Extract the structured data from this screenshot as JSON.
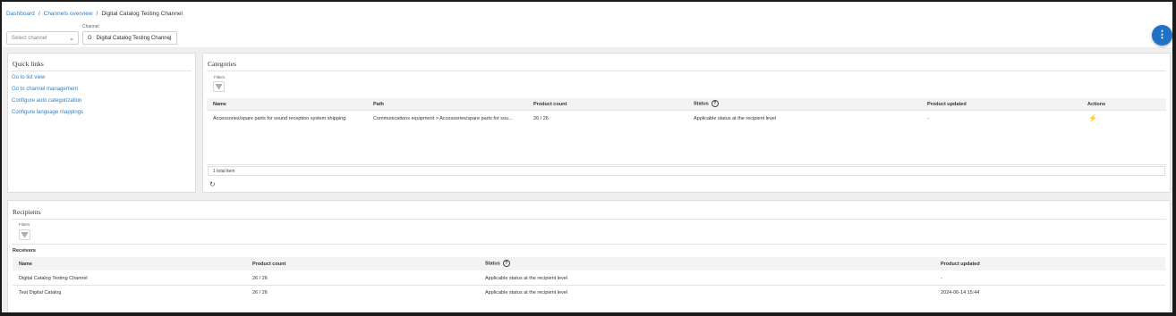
{
  "breadcrumb": {
    "items": [
      "Dashboard",
      "Channels overview"
    ],
    "current": "Digital Catalog Testing Channel"
  },
  "header": {
    "select_channel_placeholder": "Select channel",
    "channel_label": "Channel",
    "channel_value": "Digital Catalog Testing Channel",
    "channel_prefix": "G",
    "fab_icon": "more-vertical-icon"
  },
  "quick_links": {
    "title": "Quick links",
    "items": [
      "Go to list view",
      "Go to channel management",
      "Configure auto categorization",
      "Configure language mappings"
    ]
  },
  "categories": {
    "title": "Categories",
    "filters_label": "Filters",
    "columns": [
      "Name",
      "Path",
      "Product count",
      "Status",
      "Product updated",
      "Actions"
    ],
    "rows": [
      {
        "name": "Accessories/spare parts for sound reception system shipping",
        "path": "Communications equipment > Accessories/spare parts for sou...",
        "count": "26 / 26",
        "status": "Applicable status at the recipient level",
        "updated": "-"
      }
    ],
    "total": "1 total item"
  },
  "recipients": {
    "title": "Recipients",
    "filters_label": "Filters",
    "receivers_label": "Receivers",
    "columns": [
      "Name",
      "Product count",
      "Status",
      "Product updated"
    ],
    "rows": [
      {
        "name": "Digital Catalog Testing Channel",
        "count": "26 / 26",
        "status": "Applicable status at the recipient level",
        "updated": "-"
      },
      {
        "name": "Test Digital Catalog",
        "count": "26 / 26",
        "status": "Applicable status at the recipient level",
        "updated": "2024-06-14 15:44"
      }
    ]
  },
  "colors": {
    "link": "#2f7fc1",
    "accent": "#1f72c6",
    "background": "#efefef"
  }
}
